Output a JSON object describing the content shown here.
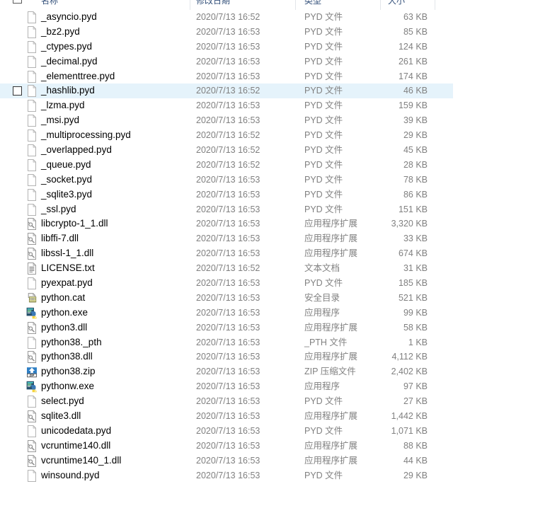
{
  "window": {
    "view": "details-list",
    "app": "windows-file-explorer"
  },
  "colors": {
    "selection_bg": "#e5f3fb",
    "header_text": "#33507a",
    "secondary_text": "#808080",
    "primary_text": "#000000",
    "divider": "#e2e6ea"
  },
  "columns": [
    {
      "key": "name",
      "label": "名称",
      "icon": "select-all-checkbox"
    },
    {
      "key": "date",
      "label": "修改日期"
    },
    {
      "key": "type",
      "label": "类型"
    },
    {
      "key": "size",
      "label": "大小"
    }
  ],
  "rows": [
    {
      "name": "_asyncio.pyd",
      "date": "2020/7/13 16:52",
      "type": "PYD 文件",
      "size": "63 KB",
      "icon": "generic-file-icon",
      "selected": false
    },
    {
      "name": "_bz2.pyd",
      "date": "2020/7/13 16:53",
      "type": "PYD 文件",
      "size": "85 KB",
      "icon": "generic-file-icon",
      "selected": false
    },
    {
      "name": "_ctypes.pyd",
      "date": "2020/7/13 16:53",
      "type": "PYD 文件",
      "size": "124 KB",
      "icon": "generic-file-icon",
      "selected": false
    },
    {
      "name": "_decimal.pyd",
      "date": "2020/7/13 16:53",
      "type": "PYD 文件",
      "size": "261 KB",
      "icon": "generic-file-icon",
      "selected": false
    },
    {
      "name": "_elementtree.pyd",
      "date": "2020/7/13 16:53",
      "type": "PYD 文件",
      "size": "174 KB",
      "icon": "generic-file-icon",
      "selected": false
    },
    {
      "name": "_hashlib.pyd",
      "date": "2020/7/13 16:52",
      "type": "PYD 文件",
      "size": "46 KB",
      "icon": "generic-file-icon",
      "selected": true
    },
    {
      "name": "_lzma.pyd",
      "date": "2020/7/13 16:53",
      "type": "PYD 文件",
      "size": "159 KB",
      "icon": "generic-file-icon",
      "selected": false
    },
    {
      "name": "_msi.pyd",
      "date": "2020/7/13 16:53",
      "type": "PYD 文件",
      "size": "39 KB",
      "icon": "generic-file-icon",
      "selected": false
    },
    {
      "name": "_multiprocessing.pyd",
      "date": "2020/7/13 16:52",
      "type": "PYD 文件",
      "size": "29 KB",
      "icon": "generic-file-icon",
      "selected": false
    },
    {
      "name": "_overlapped.pyd",
      "date": "2020/7/13 16:52",
      "type": "PYD 文件",
      "size": "45 KB",
      "icon": "generic-file-icon",
      "selected": false
    },
    {
      "name": "_queue.pyd",
      "date": "2020/7/13 16:52",
      "type": "PYD 文件",
      "size": "28 KB",
      "icon": "generic-file-icon",
      "selected": false
    },
    {
      "name": "_socket.pyd",
      "date": "2020/7/13 16:53",
      "type": "PYD 文件",
      "size": "78 KB",
      "icon": "generic-file-icon",
      "selected": false
    },
    {
      "name": "_sqlite3.pyd",
      "date": "2020/7/13 16:53",
      "type": "PYD 文件",
      "size": "86 KB",
      "icon": "generic-file-icon",
      "selected": false
    },
    {
      "name": "_ssl.pyd",
      "date": "2020/7/13 16:53",
      "type": "PYD 文件",
      "size": "151 KB",
      "icon": "generic-file-icon",
      "selected": false
    },
    {
      "name": "libcrypto-1_1.dll",
      "date": "2020/7/13 16:53",
      "type": "应用程序扩展",
      "size": "3,320 KB",
      "icon": "dll-file-icon",
      "selected": false
    },
    {
      "name": "libffi-7.dll",
      "date": "2020/7/13 16:53",
      "type": "应用程序扩展",
      "size": "33 KB",
      "icon": "dll-file-icon",
      "selected": false
    },
    {
      "name": "libssl-1_1.dll",
      "date": "2020/7/13 16:53",
      "type": "应用程序扩展",
      "size": "674 KB",
      "icon": "dll-file-icon",
      "selected": false
    },
    {
      "name": "LICENSE.txt",
      "date": "2020/7/13 16:52",
      "type": "文本文档",
      "size": "31 KB",
      "icon": "text-file-icon",
      "selected": false
    },
    {
      "name": "pyexpat.pyd",
      "date": "2020/7/13 16:53",
      "type": "PYD 文件",
      "size": "185 KB",
      "icon": "generic-file-icon",
      "selected": false
    },
    {
      "name": "python.cat",
      "date": "2020/7/13 16:53",
      "type": "安全目录",
      "size": "521 KB",
      "icon": "security-catalog-icon",
      "selected": false
    },
    {
      "name": "python.exe",
      "date": "2020/7/13 16:53",
      "type": "应用程序",
      "size": "99 KB",
      "icon": "python-exe-icon",
      "selected": false
    },
    {
      "name": "python3.dll",
      "date": "2020/7/13 16:53",
      "type": "应用程序扩展",
      "size": "58 KB",
      "icon": "dll-file-icon",
      "selected": false
    },
    {
      "name": "python38._pth",
      "date": "2020/7/13 16:53",
      "type": "_PTH 文件",
      "size": "1 KB",
      "icon": "generic-file-icon",
      "selected": false
    },
    {
      "name": "python38.dll",
      "date": "2020/7/13 16:53",
      "type": "应用程序扩展",
      "size": "4,112 KB",
      "icon": "dll-file-icon",
      "selected": false
    },
    {
      "name": "python38.zip",
      "date": "2020/7/13 16:53",
      "type": "ZIP 压缩文件",
      "size": "2,402 KB",
      "icon": "zip-file-icon",
      "selected": false
    },
    {
      "name": "pythonw.exe",
      "date": "2020/7/13 16:53",
      "type": "应用程序",
      "size": "97 KB",
      "icon": "python-exe-icon",
      "selected": false
    },
    {
      "name": "select.pyd",
      "date": "2020/7/13 16:53",
      "type": "PYD 文件",
      "size": "27 KB",
      "icon": "generic-file-icon",
      "selected": false
    },
    {
      "name": "sqlite3.dll",
      "date": "2020/7/13 16:53",
      "type": "应用程序扩展",
      "size": "1,442 KB",
      "icon": "dll-file-icon",
      "selected": false
    },
    {
      "name": "unicodedata.pyd",
      "date": "2020/7/13 16:53",
      "type": "PYD 文件",
      "size": "1,071 KB",
      "icon": "generic-file-icon",
      "selected": false
    },
    {
      "name": "vcruntime140.dll",
      "date": "2020/7/13 16:53",
      "type": "应用程序扩展",
      "size": "88 KB",
      "icon": "dll-file-icon",
      "selected": false
    },
    {
      "name": "vcruntime140_1.dll",
      "date": "2020/7/13 16:53",
      "type": "应用程序扩展",
      "size": "44 KB",
      "icon": "dll-file-icon",
      "selected": false
    },
    {
      "name": "winsound.pyd",
      "date": "2020/7/13 16:53",
      "type": "PYD 文件",
      "size": "29 KB",
      "icon": "generic-file-icon",
      "selected": false
    }
  ]
}
